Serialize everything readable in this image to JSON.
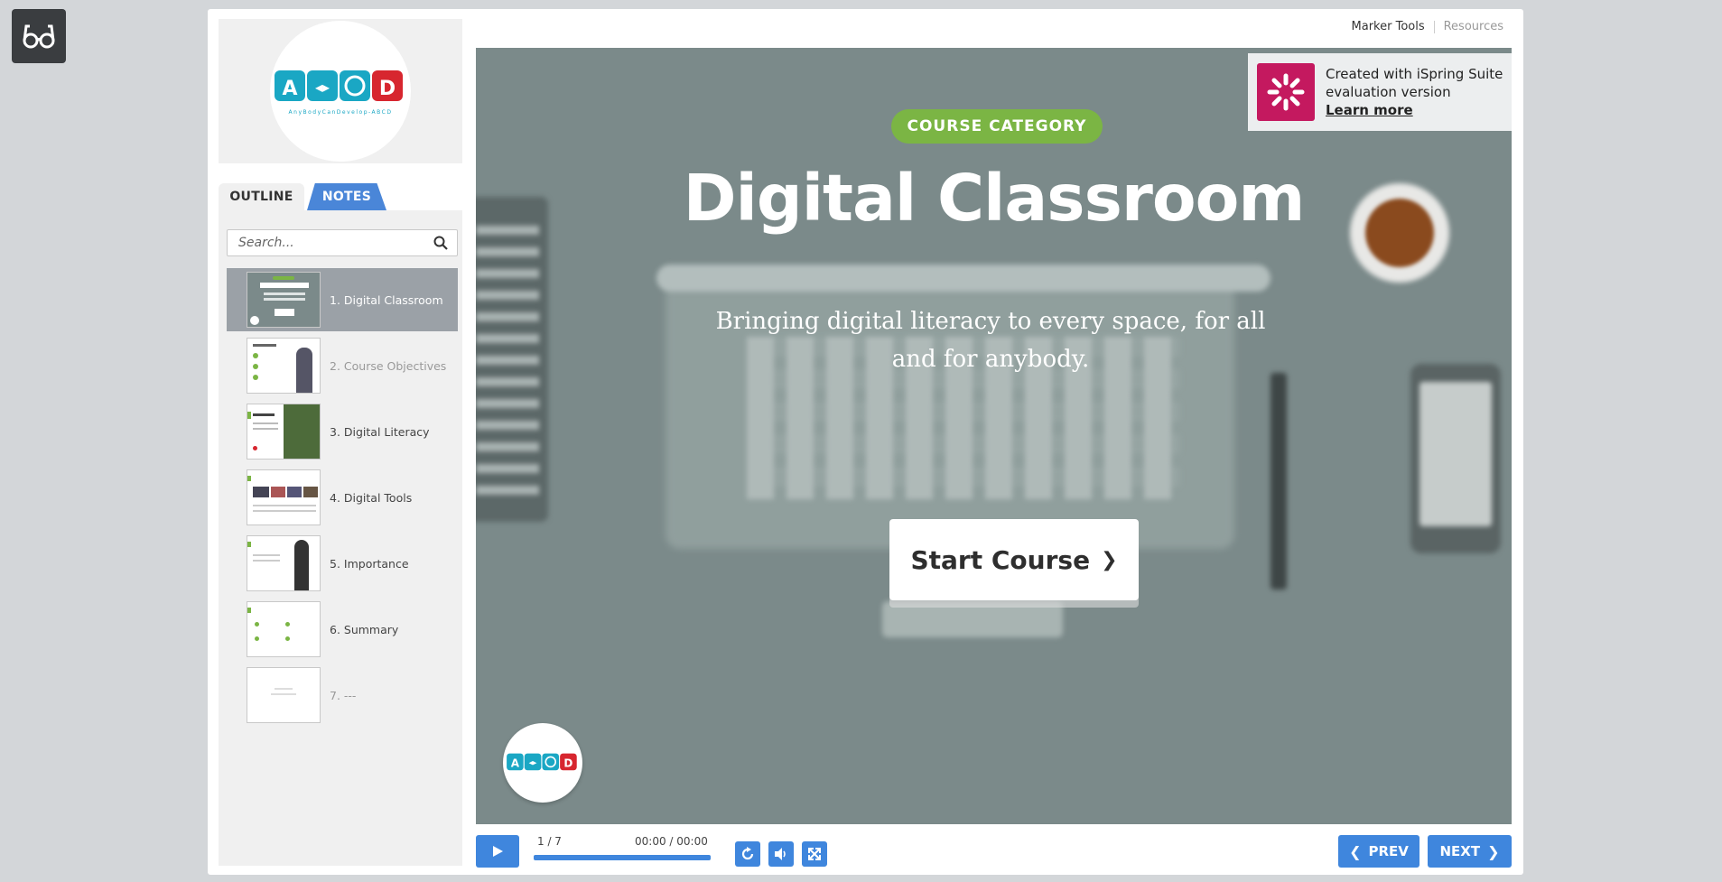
{
  "reader_icon": "glasses-icon",
  "header": {
    "links": [
      {
        "label": "Marker Tools"
      },
      {
        "label": "Resources"
      }
    ]
  },
  "sidebar": {
    "logo_text": "AnyBodyCanDevelop-ABCD",
    "tabs": [
      {
        "label": "OUTLINE"
      },
      {
        "label": "NOTES"
      }
    ],
    "search": {
      "placeholder": "Search..."
    },
    "slides": [
      {
        "label": "1. Digital Classroom"
      },
      {
        "label": "2. Course Objectives"
      },
      {
        "label": "3. Digital Literacy"
      },
      {
        "label": "4. Digital Tools"
      },
      {
        "label": "5. Importance"
      },
      {
        "label": "6. Summary"
      },
      {
        "label": "7. ---"
      }
    ]
  },
  "slide": {
    "category": "COURSE CATEGORY",
    "title": "Digital Classroom",
    "subtitle": "Bringing digital literacy to every space, for all and for anybody.",
    "start_button": "Start Course"
  },
  "ispring": {
    "line1": "Created with iSpring Suite",
    "line2": "evaluation version",
    "link": "Learn more"
  },
  "controls": {
    "counter": "1 / 7",
    "time": "00:00 / 00:00",
    "prev": "PREV",
    "next": "NEXT"
  },
  "colors": {
    "accent": "#3f86dd",
    "category_green": "#7bb544",
    "ispring_magenta": "#c4195f",
    "stage_bg": "#7b8a8a"
  }
}
